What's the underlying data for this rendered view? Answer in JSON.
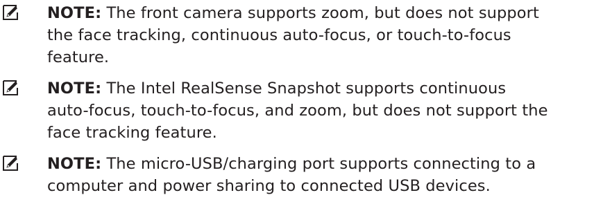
{
  "notes": [
    {
      "label": "NOTE:",
      "icon": "note-pencil-icon",
      "lines": [
        " The front camera supports zoom, but does not support",
        "the face tracking, continuous auto-focus, or touch-to-focus",
        "feature."
      ]
    },
    {
      "label": "NOTE:",
      "icon": "note-pencil-icon",
      "lines": [
        " The Intel RealSense Snapshot supports continuous",
        "auto-focus, touch-to-focus, and zoom, but does not support the",
        "face tracking feature."
      ]
    },
    {
      "label": "NOTE:",
      "icon": "note-pencil-icon",
      "lines": [
        " The micro-USB/charging port supports connecting to a",
        "computer and power sharing to connected USB devices."
      ]
    }
  ]
}
